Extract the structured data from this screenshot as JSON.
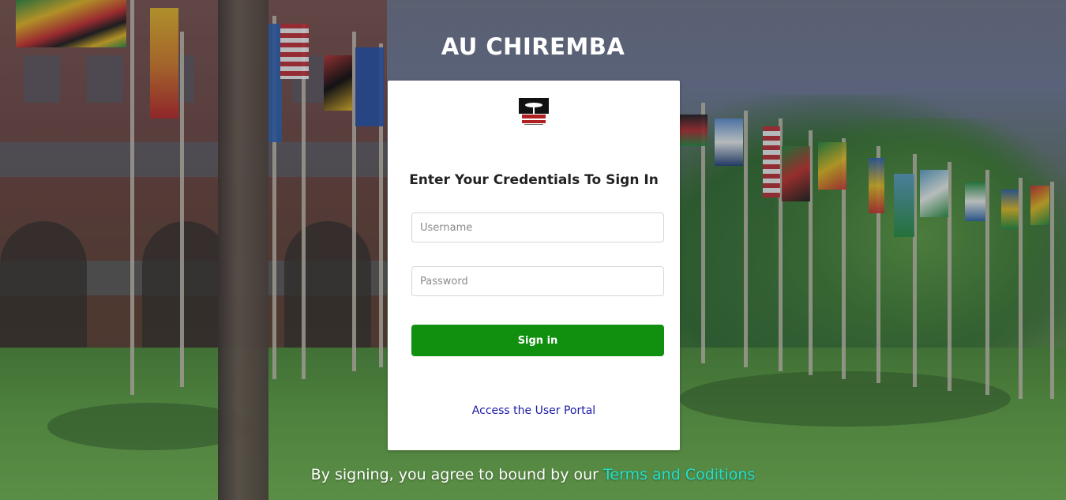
{
  "app": {
    "title": "AU CHIREMBA"
  },
  "login": {
    "logo_icon": "africa-university-logo",
    "heading": "Enter Your Credentials To Sign In",
    "username_placeholder": "Username",
    "password_placeholder": "Password",
    "signin_label": "Sign in",
    "portal_link": "Access the User Portal"
  },
  "footer": {
    "text": "By signing, you agree to bound by our ",
    "terms_link": "Terms and Coditions"
  },
  "colors": {
    "signin_button": "#119010",
    "portal_link": "#1a1aa6",
    "terms_link": "#22e0d0"
  }
}
